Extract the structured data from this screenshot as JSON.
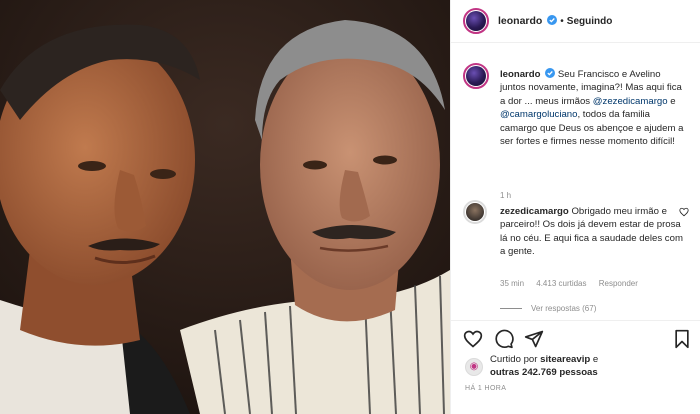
{
  "photo": {
    "alt": "",
    "colors": {
      "bg": "#2a1e18",
      "skin_left": "#a8633e",
      "skin_right": "#b07a5a",
      "hair_right": "#9a9a9a"
    }
  },
  "header": {
    "username": "leonardo",
    "separator": "•",
    "follow_status": "Seguindo",
    "more_icon": "more-dots-icon"
  },
  "caption": {
    "username": "leonardo",
    "text_1": "Seu Francisco e Avelino juntos novamente, imagina?! Mas aqui fica a dor ... meus irmãos ",
    "mention_1": "@zezedicamargo",
    "and": " e ",
    "mention_2": "@camargoluciano",
    "text_2": ", todos da familia camargo que Deus os abençoe e ajudem a ser fortes e firmes nesse momento difícil!",
    "time": "1 h"
  },
  "comment": {
    "username": "zezedicamargo",
    "text": "Obrigado meu irmão e parceiro!! Os dois já devem estar de prosa lá no céu. E aqui fica a saudade deles com a gente.",
    "time": "35 min",
    "likes": "4.413 curtidas",
    "reply": "Responder"
  },
  "view_replies": "Ver respostas (67)",
  "likes": {
    "prefix": "Curtido por ",
    "by_user": "siteareavip",
    "and": " e",
    "others": "outras 242.769 pessoas"
  },
  "posted": "HÁ 1 HORA",
  "accent": {
    "verified": "#3897f0",
    "mention": "#00376b",
    "meta": "#8e8e8e"
  }
}
